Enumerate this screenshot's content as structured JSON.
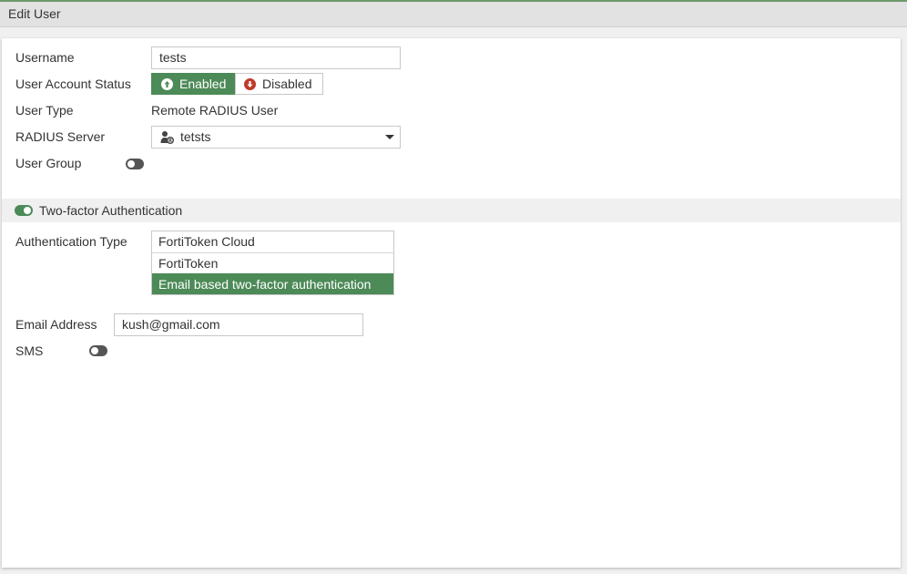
{
  "header": {
    "title": "Edit User"
  },
  "form": {
    "username": {
      "label": "Username",
      "value": "tests"
    },
    "account_status": {
      "label": "User Account Status",
      "enabled_label": "Enabled",
      "disabled_label": "Disabled",
      "selected": "Enabled"
    },
    "user_type": {
      "label": "User Type",
      "value": "Remote RADIUS User"
    },
    "radius_server": {
      "label": "RADIUS Server",
      "value": "tetsts"
    },
    "user_group": {
      "label": "User Group",
      "enabled": false
    },
    "two_factor": {
      "title": "Two-factor Authentication",
      "enabled": true
    },
    "auth_type": {
      "label": "Authentication Type",
      "options": [
        "FortiToken Cloud",
        "FortiToken",
        "Email based two-factor authentication"
      ],
      "selected_index": 2
    },
    "email": {
      "label": "Email Address",
      "value": "kush@gmail.com"
    },
    "sms": {
      "label": "SMS",
      "enabled": false
    }
  },
  "colors": {
    "accent": "#4c8a57",
    "disabled_icon": "#c0392b",
    "header_bg": "#e2e2e2"
  }
}
